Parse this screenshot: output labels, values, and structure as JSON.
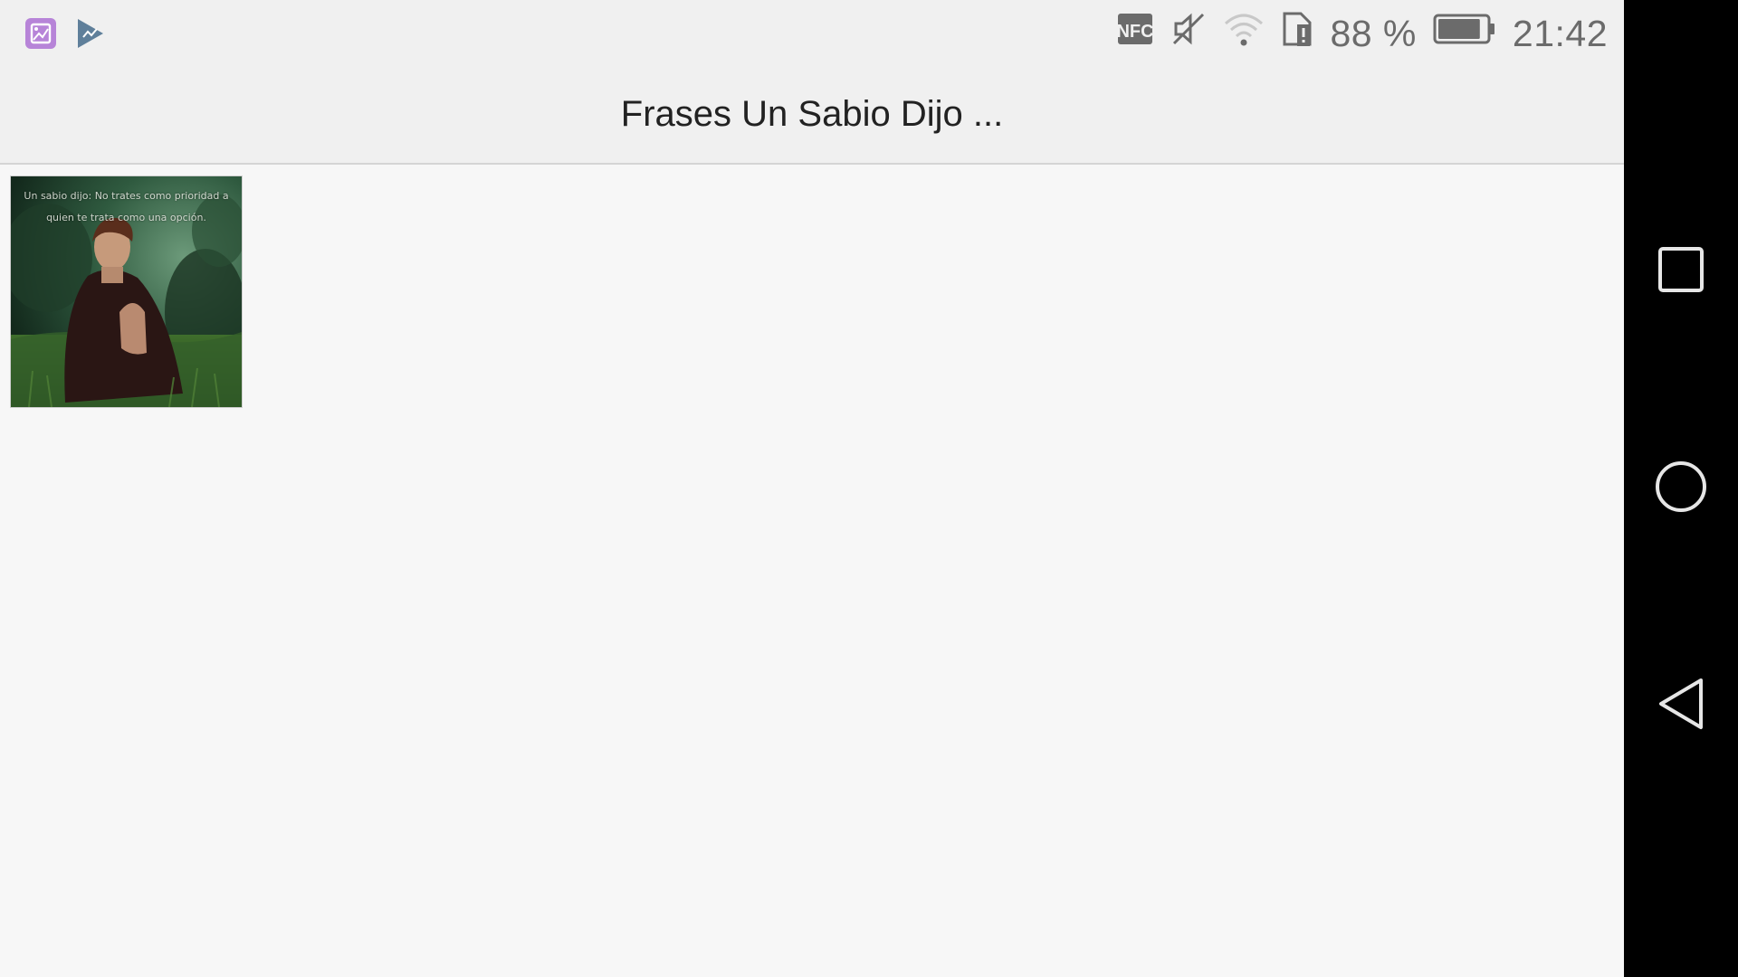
{
  "status_bar": {
    "battery_percent": "88 %",
    "time": "21:42",
    "battery_level": 0.88,
    "left_icons": [
      "gallery-notification-icon",
      "play-store-notification-icon"
    ],
    "right_icons": [
      "nfc-icon",
      "mute-icon",
      "wifi-icon",
      "sim-alert-icon",
      "battery-icon"
    ]
  },
  "app_bar": {
    "title": "Frases Un Sabio Dijo ..."
  },
  "gallery": {
    "items": [
      {
        "caption": "Un sabio dijo: No trates como prioridad a quien te trata como una opción."
      }
    ]
  },
  "navigation": {
    "buttons": [
      "recents-button",
      "home-button",
      "back-button"
    ]
  },
  "colors": {
    "background": "#f7f7f7",
    "bar_background": "#f0f0f0",
    "status_icon": "#6b6b6b",
    "gallery_icon": "#b784d8",
    "nav_background": "#000000"
  }
}
